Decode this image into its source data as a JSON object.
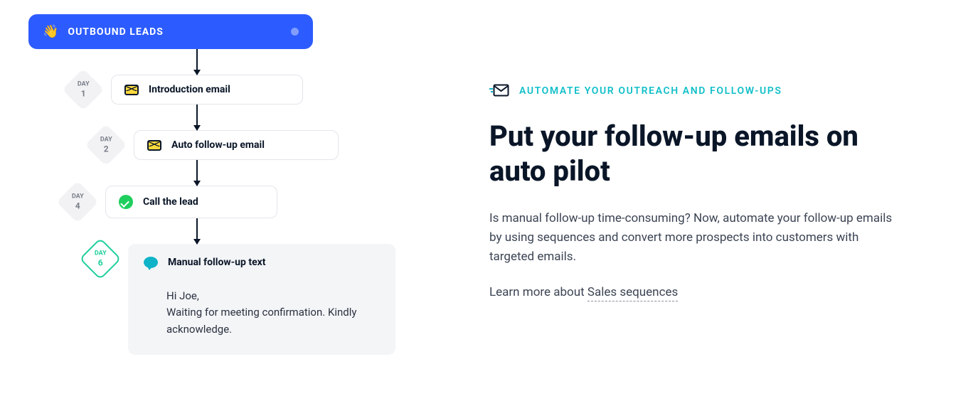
{
  "header": {
    "title": "OUTBOUND LEADS",
    "wave_icon": "wave-icon"
  },
  "steps": [
    {
      "day_label": "DAY",
      "day_num": "1",
      "icon": "email",
      "label": "Introduction email"
    },
    {
      "day_label": "DAY",
      "day_num": "2",
      "icon": "email",
      "label": "Auto follow-up email"
    },
    {
      "day_label": "DAY",
      "day_num": "4",
      "icon": "check",
      "label": "Call the lead"
    },
    {
      "day_label": "DAY",
      "day_num": "6",
      "icon": "chat",
      "label": "Manual follow-up text",
      "body_line1": "Hi Joe,",
      "body_line2": "Waiting for meeting confirmation. Kindly acknowledge."
    }
  ],
  "right": {
    "eyebrow": "AUTOMATE YOUR OUTREACH AND FOLLOW-UPS",
    "headline": "Put your follow-up emails on auto pilot",
    "body": "Is manual follow-up time-consuming? Now, automate your follow-up emails by using sequences and convert more prospects into customers with targeted emails.",
    "learn_more_prefix": "Learn more about ",
    "learn_more_link": "Sales sequences"
  }
}
